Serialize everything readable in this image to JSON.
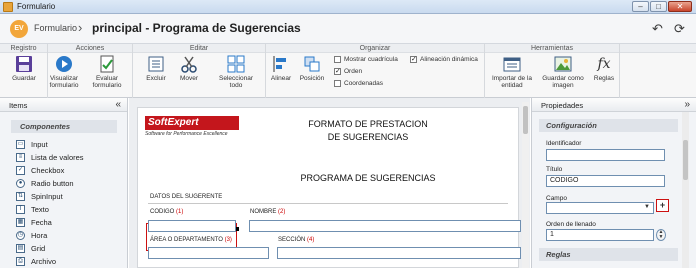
{
  "window": {
    "title": "Formulario"
  },
  "header": {
    "breadcrumb": "Formulario",
    "separator": "›",
    "title": "principal - Programa de Sugerencias"
  },
  "ribbon": {
    "groups": [
      "Registro",
      "Acciones",
      "Editar",
      "Organizar",
      "Herramientas"
    ],
    "buttons": {
      "guardar": "Guardar",
      "visualizar": "Visualizar formulario",
      "evaluar": "Evaluar formulario",
      "excluir": "Excluir",
      "mover": "Mover",
      "seleccionar": "Seleccionar todo",
      "alinear": "Alinear",
      "posicion": "Posición",
      "importar": "Importar de la entidad",
      "guardar_imagen": "Guardar como imagen",
      "reglas": "Reglas"
    },
    "checks": {
      "cuadricula": "Mostrar cuadrícula",
      "orden": "Orden",
      "coordenadas": "Coordenadas",
      "alineacion": "Alineación dinámica"
    }
  },
  "left_panel": {
    "title": "Items",
    "collapse": "«",
    "components_title": "Componentes",
    "items": [
      "Input",
      "Lista de valores",
      "Checkbox",
      "Radio button",
      "SpinInput",
      "Texto",
      "Fecha",
      "Hora",
      "Grid",
      "Archivo"
    ]
  },
  "form": {
    "logo_text": "SoftExpert",
    "logo_tagline": "Software for Performance Excellence",
    "title_line1": "FORMATO DE PRESTACION",
    "title_line2": "DE SUGERENCIAS",
    "subtitle": "PROGRAMA DE SUGERENCIAS",
    "section": "DATOS DEL SUGERENTE",
    "fields": {
      "codigo": "CODIGO",
      "codigo_n": "(1)",
      "nombre": "NOMBRE",
      "nombre_n": "(2)",
      "area": "ÁREA O DEPARTAMENTO",
      "area_n": "(3)",
      "seccion": "SECCIÓN",
      "seccion_n": "(4)"
    }
  },
  "right_panel": {
    "title": "Propiedades",
    "collapse": "»",
    "config_title": "Configuración",
    "identificador_label": "Identificador",
    "identificador_value": "",
    "titulo_label": "Título",
    "titulo_value": "CODIGO",
    "campo_label": "Campo",
    "campo_value": "",
    "orden_label": "Orden de llenado",
    "orden_value": "1",
    "reglas_title": "Reglas"
  }
}
